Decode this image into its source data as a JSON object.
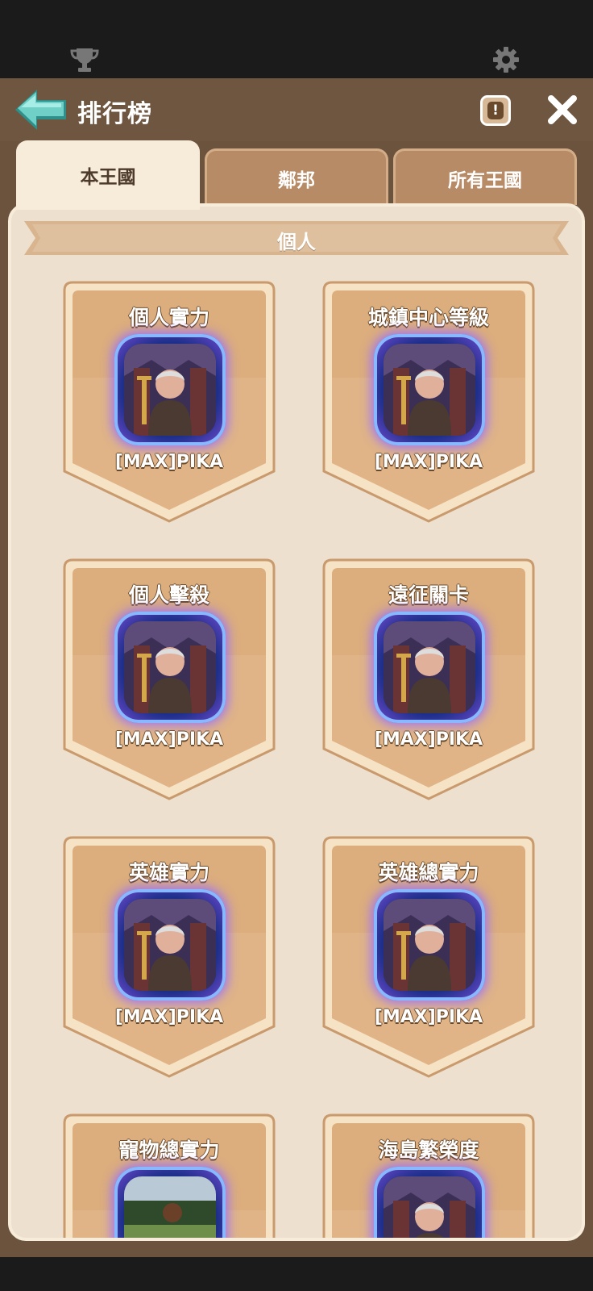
{
  "header": {
    "title": "排行榜"
  },
  "tabs": [
    {
      "label": "本王國",
      "active": true
    },
    {
      "label": "鄰邦",
      "active": false
    },
    {
      "label": "所有王國",
      "active": false
    }
  ],
  "section": {
    "title": "個人"
  },
  "cards": [
    {
      "title": "個人實力",
      "player": "[MAX]PIKA"
    },
    {
      "title": "城鎮中心等級",
      "player": "[MAX]PIKA"
    },
    {
      "title": "個人擊殺",
      "player": "[MAX]PIKA"
    },
    {
      "title": "遠征關卡",
      "player": "[MAX]PIKA"
    },
    {
      "title": "英雄實力",
      "player": "[MAX]PIKA"
    },
    {
      "title": "英雄總實力",
      "player": "[MAX]PIKA"
    },
    {
      "title": "寵物總實力",
      "player": ""
    },
    {
      "title": "海島繁榮度",
      "player": ""
    }
  ],
  "colors": {
    "accent_back": "#6fd0c8",
    "tab_active": "#f7ebd9",
    "tab_inactive": "#b78b65",
    "card": "#e0b487"
  }
}
